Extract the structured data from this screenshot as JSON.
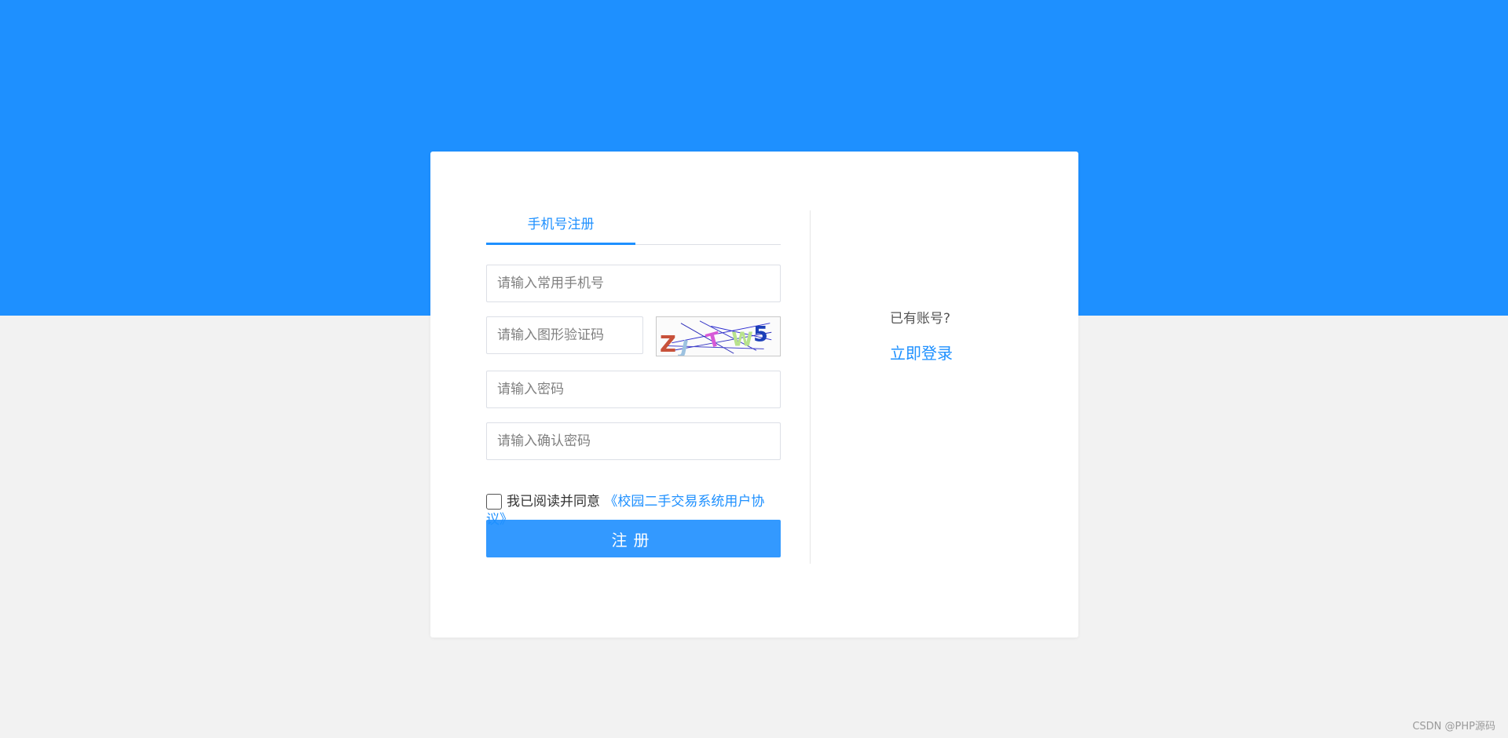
{
  "tabs": {
    "phone_register": "手机号注册"
  },
  "form": {
    "phone_placeholder": "请输入常用手机号",
    "captcha_placeholder": "请输入图形验证码",
    "password_placeholder": "请输入密码",
    "confirm_placeholder": "请输入确认密码",
    "captcha_chars": [
      "Z",
      "J",
      "T",
      "W",
      "5"
    ],
    "agree_text": "我已阅读并同意",
    "agreement_link_line1": "《校园二手交易系统用户协",
    "agreement_link_line2": "议》",
    "register_button": "注册"
  },
  "login": {
    "question": "已有账号?",
    "link": "立即登录"
  },
  "watermark": "CSDN @PHP源码",
  "colors": {
    "accent": "#1e90ff",
    "button": "#3399ff",
    "background": "#f2f2f2"
  }
}
